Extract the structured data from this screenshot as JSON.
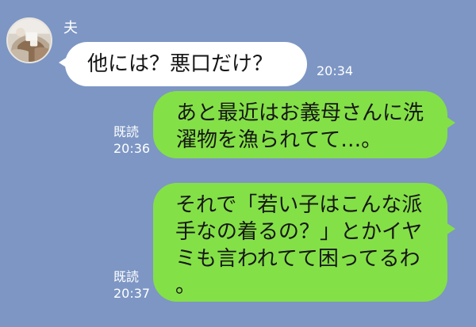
{
  "chat": {
    "sender_name": "夫",
    "messages": [
      {
        "direction": "incoming",
        "text": "他には？悪口だけ？",
        "time": "20:34"
      },
      {
        "direction": "outgoing",
        "text": "あと最近はお義母さんに洗\n濯物を漁られてて…。",
        "read_label": "既読",
        "time": "20:36"
      },
      {
        "direction": "outgoing",
        "text": "それで「若い子はこんな派\n手なの着るの？」とかイヤ\nミも言われてて困ってるわ\n。",
        "read_label": "既読",
        "time": "20:37"
      }
    ]
  },
  "avatar": {
    "icon": "profile-photo-icon"
  },
  "colors": {
    "background": "#7d96c4",
    "incoming_bubble": "#ffffff",
    "outgoing_bubble": "#84e047"
  }
}
